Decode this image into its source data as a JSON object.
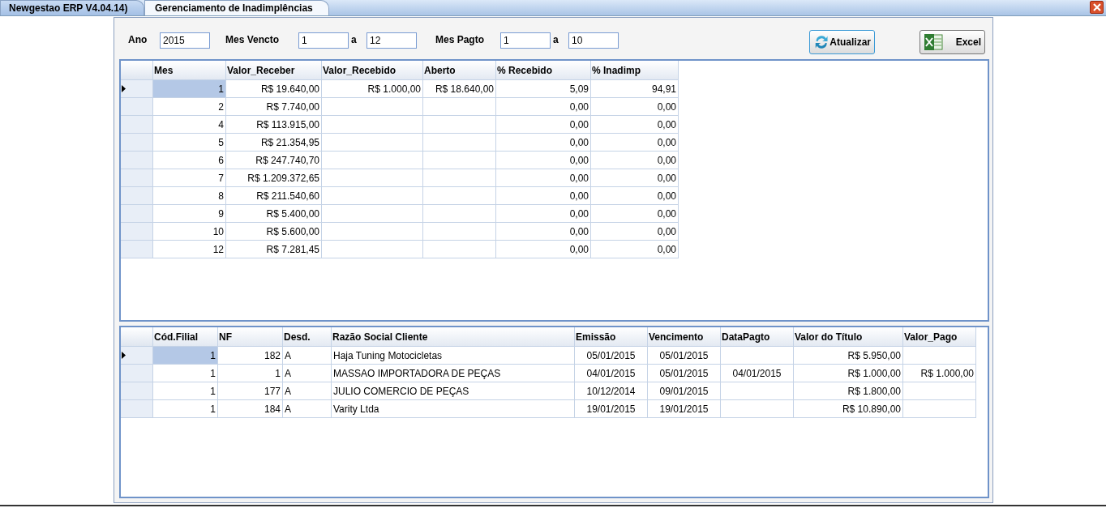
{
  "tabs": [
    {
      "label": "Newgestao ERP V4.04.14)",
      "selected": false
    },
    {
      "label": "Gerenciamento de Inadimplências",
      "selected": true
    }
  ],
  "filters": {
    "ano_label": "Ano",
    "ano": "2015",
    "vencto_label": "Mes Vencto",
    "vencto_from": "1",
    "vencto_sep": "a",
    "vencto_to": "12",
    "pagto_label": "Mes Pagto",
    "pagto_from": "1",
    "pagto_sep": "a",
    "pagto_to": "10"
  },
  "buttons": [
    {
      "kind": "refresh",
      "label": "Atualizar"
    },
    {
      "kind": "excel",
      "label": "Excel"
    }
  ],
  "summary_table": {
    "columns": [
      "Mes",
      "Valor_Receber",
      "Valor_Recebido",
      "Aberto",
      "% Recebido",
      "% Inadimp"
    ],
    "rows": [
      {
        "selected": true,
        "cells": [
          "1",
          "R$ 19.640,00",
          "R$ 1.000,00",
          "R$ 18.640,00",
          "5,09",
          "94,91"
        ]
      },
      {
        "selected": false,
        "cells": [
          "2",
          "R$ 7.740,00",
          "",
          "",
          "0,00",
          "0,00"
        ]
      },
      {
        "selected": false,
        "cells": [
          "4",
          "R$ 113.915,00",
          "",
          "",
          "0,00",
          "0,00"
        ]
      },
      {
        "selected": false,
        "cells": [
          "5",
          "R$ 21.354,95",
          "",
          "",
          "0,00",
          "0,00"
        ]
      },
      {
        "selected": false,
        "cells": [
          "6",
          "R$ 247.740,70",
          "",
          "",
          "0,00",
          "0,00"
        ]
      },
      {
        "selected": false,
        "cells": [
          "7",
          "R$ 1.209.372,65",
          "",
          "",
          "0,00",
          "0,00"
        ]
      },
      {
        "selected": false,
        "cells": [
          "8",
          "R$ 211.540,60",
          "",
          "",
          "0,00",
          "0,00"
        ]
      },
      {
        "selected": false,
        "cells": [
          "9",
          "R$ 5.400,00",
          "",
          "",
          "0,00",
          "0,00"
        ]
      },
      {
        "selected": false,
        "cells": [
          "10",
          "R$ 5.600,00",
          "",
          "",
          "0,00",
          "0,00"
        ]
      },
      {
        "selected": false,
        "cells": [
          "12",
          "R$ 7.281,45",
          "",
          "",
          "0,00",
          "0,00"
        ]
      }
    ]
  },
  "detail_table": {
    "columns": [
      "Cód.Filial",
      "NF",
      "Desd.",
      "Razão Social Cliente",
      "Emissão",
      "Vencimento",
      "DataPagto",
      "Valor do Título",
      "Valor_Pago"
    ],
    "rows": [
      {
        "selected": true,
        "cells": [
          "1",
          "182",
          "A",
          "Haja Tuning Motocicletas",
          "05/01/2015",
          "05/01/2015",
          "",
          "R$ 5.950,00",
          ""
        ]
      },
      {
        "selected": false,
        "cells": [
          "1",
          "1",
          "A",
          "MASSAO IMPORTADORA DE PEÇAS",
          "04/01/2015",
          "05/01/2015",
          "04/01/2015",
          "R$ 1.000,00",
          "R$ 1.000,00"
        ]
      },
      {
        "selected": false,
        "cells": [
          "1",
          "177",
          "A",
          "JULIO COMERCIO DE PEÇAS",
          "10/12/2014",
          "09/01/2015",
          "",
          "R$ 1.800,00",
          ""
        ]
      },
      {
        "selected": false,
        "cells": [
          "1",
          "184",
          "A",
          "Varity Ltda",
          "19/01/2015",
          "19/01/2015",
          "",
          "R$ 10.890,00",
          ""
        ]
      }
    ]
  }
}
